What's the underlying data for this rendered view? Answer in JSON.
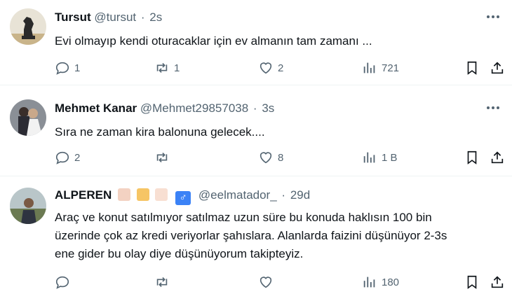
{
  "tweets": [
    {
      "name": "Tursut",
      "handle": "@tursut",
      "time": "2s",
      "text": "Evi olmayıp kendi oturacaklar için ev almanın tam zamanı ...",
      "replies": "1",
      "retweets": "1",
      "likes": "2",
      "views": "721",
      "avatar_icon": "chess-knight-avatar"
    },
    {
      "name": "Mehmet Kanar",
      "handle": "@Mehmet29857038",
      "time": "3s",
      "text": "Sıra ne zaman kira balonuna gelecek....",
      "replies": "2",
      "retweets": "",
      "likes": "8",
      "views": "1 B",
      "avatar_icon": "wedding-couple-avatar"
    },
    {
      "name": "ALPEREN",
      "handle": "@eelmatador_",
      "time": "29d",
      "text_line1": "Araç ve konut satılmıyor satılmaz uzun süre bu konuda haklısın 100 bin",
      "text_line2": "üzerinde çok az kredi veriyorlar şahıslara. Alanlarda faizini düşünüyor  2-3s",
      "text_line3": "ene gider bu olay diye düşünüyorum takipteyiz.",
      "replies": "",
      "retweets": "",
      "likes": "",
      "views": "180",
      "badges": [
        "punch-emoji",
        "pray-emoji",
        "skin-tone-emoji",
        "male-sign"
      ],
      "male_sign": "♂",
      "avatar_icon": "man-outdoors-avatar"
    }
  ],
  "colors": {
    "text": "#0f1419",
    "muted": "#536471",
    "border": "#eff3f4",
    "male_badge": "#3b82f6"
  }
}
